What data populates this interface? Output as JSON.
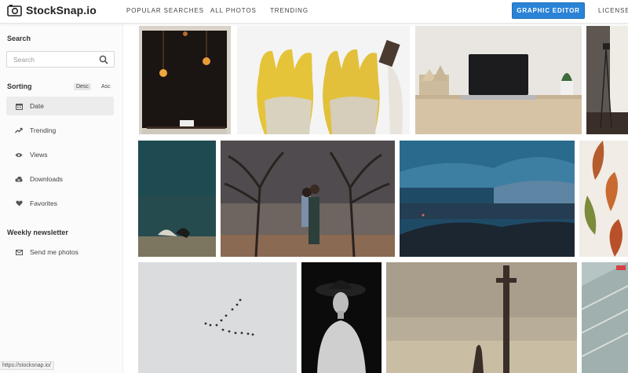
{
  "brand": {
    "name": "StockSnap.io"
  },
  "nav": {
    "popular": "POPULAR SEARCHES",
    "all_photos": "ALL PHOTOS",
    "trending": "TRENDING",
    "editor": "GRAPHIC EDITOR",
    "license": "LICENSE"
  },
  "sidebar": {
    "search_heading": "Search",
    "search_placeholder": "Search",
    "sorting_heading": "Sorting",
    "sort_desc": "Desc",
    "sort_asc": "Asc",
    "sort_items": [
      {
        "label": "Date",
        "icon": "calendar-icon"
      },
      {
        "label": "Trending",
        "icon": "trending-icon"
      },
      {
        "label": "Views",
        "icon": "eye-icon"
      },
      {
        "label": "Downloads",
        "icon": "cloud-download-icon"
      },
      {
        "label": "Favorites",
        "icon": "heart-icon"
      }
    ],
    "newsletter_heading": "Weekly newsletter",
    "newsletter_item": {
      "label": "Send me photos",
      "icon": "envelope-icon"
    }
  },
  "status_url": "https://stocksnap.io/",
  "colors": {
    "accent": "#2a83d6"
  }
}
